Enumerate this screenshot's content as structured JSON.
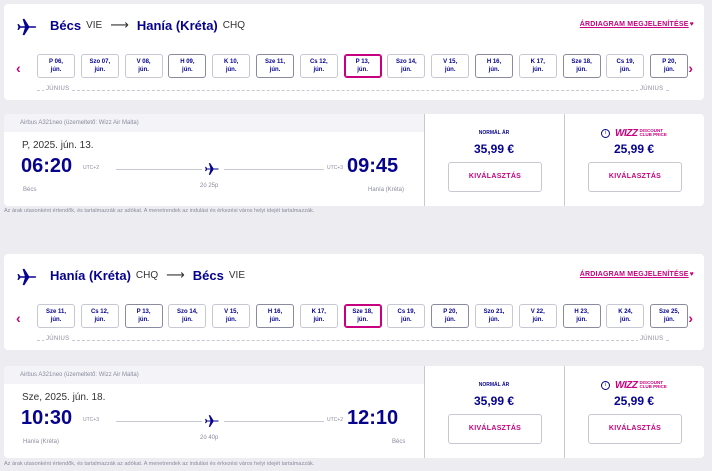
{
  "sections": [
    {
      "route": {
        "from": "Bécs",
        "from_code": "VIE",
        "to": "Hanía (Kréta)",
        "to_code": "CHQ"
      },
      "price_chart_link": "ÁRDIAGRAM MEGJELENÍTÉSE",
      "dates": [
        {
          "day": "P 06,",
          "month": "jún.",
          "style": "plain"
        },
        {
          "day": "Szo 07,",
          "month": "jún.",
          "style": "plain"
        },
        {
          "day": "V 08,",
          "month": "jún.",
          "style": "plain"
        },
        {
          "day": "H 09,",
          "month": "jún.",
          "style": "boxed"
        },
        {
          "day": "K 10,",
          "month": "jún.",
          "style": "plain"
        },
        {
          "day": "Sze 11,",
          "month": "jún.",
          "style": "boxed"
        },
        {
          "day": "Cs 12,",
          "month": "jún.",
          "style": "plain"
        },
        {
          "day": "P 13,",
          "month": "jún.",
          "style": "selected"
        },
        {
          "day": "Szo 14,",
          "month": "jún.",
          "style": "plain"
        },
        {
          "day": "V 15,",
          "month": "jún.",
          "style": "plain"
        },
        {
          "day": "H 16,",
          "month": "jún.",
          "style": "boxed"
        },
        {
          "day": "K 17,",
          "month": "jún.",
          "style": "plain"
        },
        {
          "day": "Sze 18,",
          "month": "jún.",
          "style": "boxed"
        },
        {
          "day": "Cs 19,",
          "month": "jún.",
          "style": "plain"
        },
        {
          "day": "P 20,",
          "month": "jún.",
          "style": "boxed"
        }
      ],
      "month_label": "JÚNIUS",
      "flight": {
        "aircraft": "Airbus A321neo (üzemeltető: Wizz Air Malta)",
        "date": "P, 2025. jún. 13.",
        "dep_time": "06:20",
        "dep_tz": "UTC+2",
        "dep_city": "Bécs",
        "arr_time": "09:45",
        "arr_tz": "UTC+3",
        "arr_city": "Hanía (Kréta)",
        "duration": "2ó 25p"
      },
      "fares": {
        "normal_label": "NORMÁL ÁR",
        "normal_price": "35,99 €",
        "club_word": "WIZZ",
        "club_text1": "DISCOUNT",
        "club_text2": "CLUB PRICE",
        "club_price": "25,99 €",
        "select_label": "KIVÁLASZTÁS"
      },
      "footnote": "Az árak utasonként értendők, és tartalmazzák az adókat. A menetrendek az indulási és érkezési város helyi idejét tartalmazzák."
    },
    {
      "route": {
        "from": "Hanía (Kréta)",
        "from_code": "CHQ",
        "to": "Bécs",
        "to_code": "VIE"
      },
      "price_chart_link": "ÁRDIAGRAM MEGJELENÍTÉSE",
      "dates": [
        {
          "day": "Sze 11,",
          "month": "jún.",
          "style": "plain"
        },
        {
          "day": "Cs 12,",
          "month": "jún.",
          "style": "plain"
        },
        {
          "day": "P 13,",
          "month": "jún.",
          "style": "boxed"
        },
        {
          "day": "Szo 14,",
          "month": "jún.",
          "style": "plain"
        },
        {
          "day": "V 15,",
          "month": "jún.",
          "style": "plain"
        },
        {
          "day": "H 16,",
          "month": "jún.",
          "style": "boxed"
        },
        {
          "day": "K 17,",
          "month": "jún.",
          "style": "plain"
        },
        {
          "day": "Sze 18,",
          "month": "jún.",
          "style": "selected"
        },
        {
          "day": "Cs 19,",
          "month": "jún.",
          "style": "plain"
        },
        {
          "day": "P 20,",
          "month": "jún.",
          "style": "boxed"
        },
        {
          "day": "Szo 21,",
          "month": "jún.",
          "style": "plain"
        },
        {
          "day": "V 22,",
          "month": "jún.",
          "style": "plain"
        },
        {
          "day": "H 23,",
          "month": "jún.",
          "style": "boxed"
        },
        {
          "day": "K 24,",
          "month": "jún.",
          "style": "plain"
        },
        {
          "day": "Sze 25,",
          "month": "jún.",
          "style": "boxed"
        }
      ],
      "month_label": "JÚNIUS",
      "flight": {
        "aircraft": "Airbus A321neo (üzemeltető: Wizz Air Malta)",
        "date": "Sze, 2025. jún. 18.",
        "dep_time": "10:30",
        "dep_tz": "UTC+3",
        "dep_city": "Hanía (Kréta)",
        "arr_time": "12:10",
        "arr_tz": "UTC+2",
        "arr_city": "Bécs",
        "duration": "2ó 40p"
      },
      "fares": {
        "normal_label": "NORMÁL ÁR",
        "normal_price": "35,99 €",
        "club_word": "WIZZ",
        "club_text1": "DISCOUNT",
        "club_text2": "CLUB PRICE",
        "club_price": "25,99 €",
        "select_label": "KIVÁLASZTÁS"
      },
      "footnote": "Az árak utasonként értendők, és tartalmazzák az adókat. A menetrendek az indulási és érkezési város helyi idejét tartalmazzák."
    }
  ],
  "colors": {
    "brand_blue": "#06038d",
    "brand_pink": "#c6007e",
    "background": "#ececf1"
  },
  "icons": [
    "airplane-icon",
    "arrow-right-icon",
    "heart-icon",
    "chevron-left-icon",
    "chevron-right-icon",
    "info-icon"
  ]
}
